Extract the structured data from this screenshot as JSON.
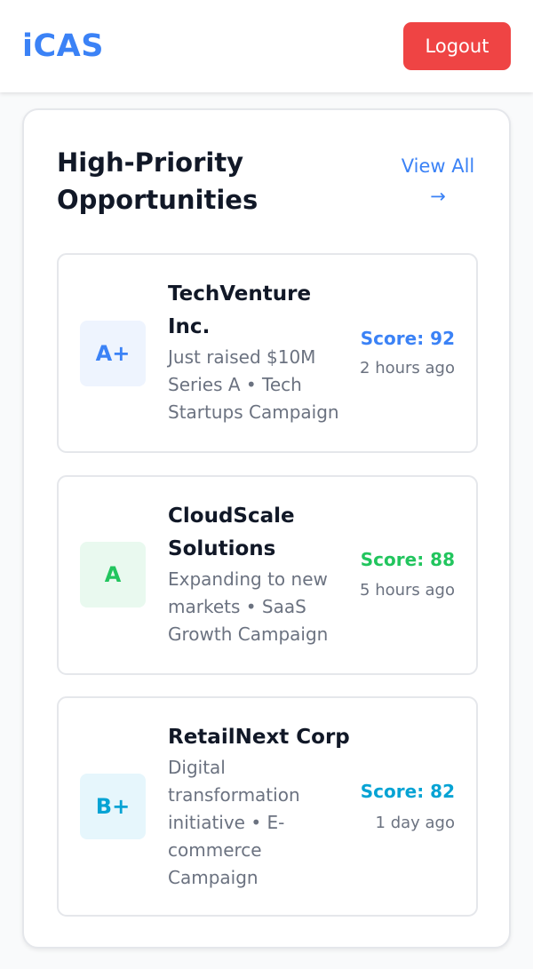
{
  "header": {
    "logo": "iCAS",
    "logout_label": "Logout"
  },
  "panel": {
    "title": "High-Priority Opportunities",
    "view_all_label": "View All",
    "view_all_arrow": "→"
  },
  "opportunities": [
    {
      "grade": "A+",
      "name": "TechVenture Inc.",
      "description": "Just raised $10M Series A • Tech Startups Campaign",
      "score": "Score: 92",
      "time": "2 hours ago",
      "accent_color": "#3b82f6",
      "badge_bg": "#eef4fe"
    },
    {
      "grade": "A",
      "name": "CloudScale Solutions",
      "description": "Expanding to new markets • SaaS Growth Campaign",
      "score": "Score: 88",
      "time": "5 hours ago",
      "accent_color": "#22c55e",
      "badge_bg": "#e9f9ef"
    },
    {
      "grade": "B+",
      "name": "RetailNext Corp",
      "description": "Digital transformation initiative • E-commerce Campaign",
      "score": "Score: 82",
      "time": "1 day ago",
      "accent_color": "#06a3d4",
      "badge_bg": "#e6f6fc"
    }
  ],
  "colors": {
    "brand": "#3b82f6",
    "logout": "#ef4444",
    "text_primary": "#111827",
    "text_muted": "#6b7280",
    "border": "#e5e7eb"
  }
}
